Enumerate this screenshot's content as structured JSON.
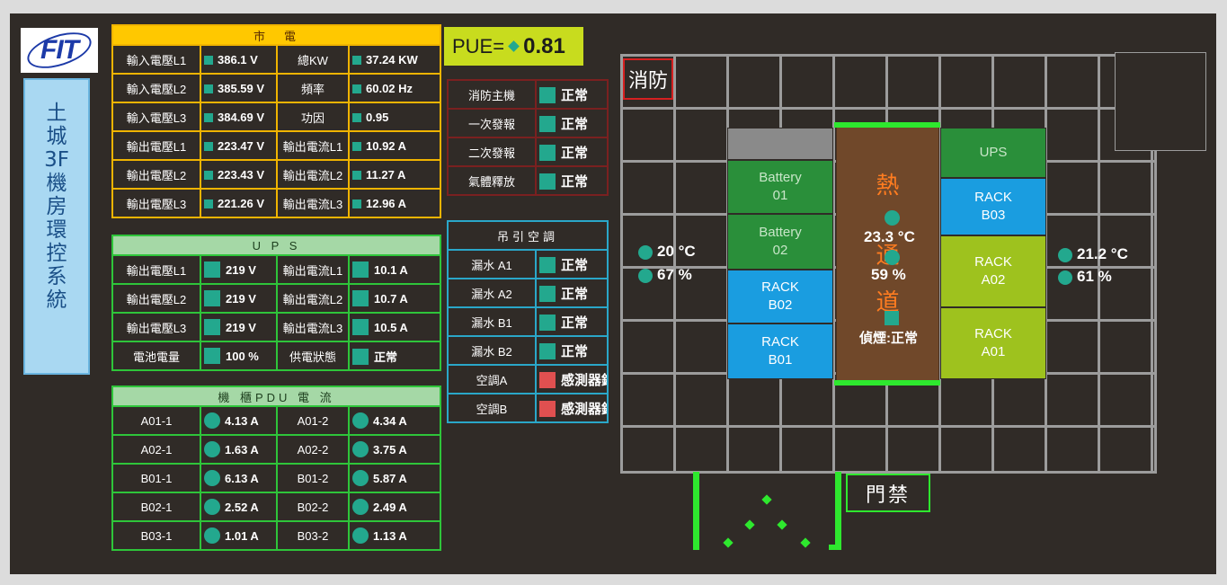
{
  "logo_text": "FIT",
  "system_title": "土城3F機房環控系統",
  "mains": {
    "header": "市　電",
    "rows": [
      {
        "l1": "輸入電壓L1",
        "v1": "386.1 V",
        "l2": "總KW",
        "v2": "37.24 KW"
      },
      {
        "l1": "輸入電壓L2",
        "v1": "385.59 V",
        "l2": "頻率",
        "v2": "60.02 Hz"
      },
      {
        "l1": "輸入電壓L3",
        "v1": "384.69 V",
        "l2": "功因",
        "v2": "0.95"
      },
      {
        "l1": "輸出電壓L1",
        "v1": "223.47 V",
        "l2": "輸出電流L1",
        "v2": "10.92 A"
      },
      {
        "l1": "輸出電壓L2",
        "v1": "223.43 V",
        "l2": "輸出電流L2",
        "v2": "11.27 A"
      },
      {
        "l1": "輸出電壓L3",
        "v1": "221.26 V",
        "l2": "輸出電流L3",
        "v2": "12.96 A"
      }
    ]
  },
  "ups": {
    "header": "U P S",
    "rows": [
      {
        "l1": "輸出電壓L1",
        "v1": "219 V",
        "l2": "輸出電流L1",
        "v2": "10.1 A"
      },
      {
        "l1": "輸出電壓L2",
        "v1": "219 V",
        "l2": "輸出電流L2",
        "v2": "10.7 A"
      },
      {
        "l1": "輸出電壓L3",
        "v1": "219 V",
        "l2": "輸出電流L3",
        "v2": "10.5 A"
      },
      {
        "l1": "電池電量",
        "v1": "100 %",
        "l2": "供電狀態",
        "v2": "正常"
      }
    ]
  },
  "pdu": {
    "header": "機 櫃PDU 電 流",
    "rows": [
      {
        "l1": "A01-1",
        "v1": "4.13 A",
        "l2": "A01-2",
        "v2": "4.34 A"
      },
      {
        "l1": "A02-1",
        "v1": "1.63 A",
        "l2": "A02-2",
        "v2": "3.75 A"
      },
      {
        "l1": "B01-1",
        "v1": "6.13 A",
        "l2": "B01-2",
        "v2": "5.87 A"
      },
      {
        "l1": "B02-1",
        "v1": "2.52 A",
        "l2": "B02-2",
        "v2": "2.49 A"
      },
      {
        "l1": "B03-1",
        "v1": "1.01 A",
        "l2": "B03-2",
        "v2": "1.13 A"
      }
    ]
  },
  "pue": {
    "label": "PUE=",
    "value": "0.81"
  },
  "fire": {
    "rows": [
      {
        "label": "消防主機",
        "status": "正常"
      },
      {
        "label": "一次發報",
        "status": "正常"
      },
      {
        "label": "二次發報",
        "status": "正常"
      },
      {
        "label": "氣體釋放",
        "status": "正常"
      }
    ]
  },
  "ac": {
    "header": "吊引空調",
    "rows": [
      {
        "label": "漏水 A1",
        "status": "正常",
        "state": "ok"
      },
      {
        "label": "漏水 A2",
        "status": "正常",
        "state": "ok"
      },
      {
        "label": "漏水 B1",
        "status": "正常",
        "state": "ok"
      },
      {
        "label": "漏水 B2",
        "status": "正常",
        "state": "ok"
      },
      {
        "label": "空調A",
        "status": "感測器錯誤",
        "state": "error"
      },
      {
        "label": "空調B",
        "status": "感測器錯誤",
        "state": "error"
      }
    ]
  },
  "floorplan": {
    "fire_label": "消防",
    "door_label": "門禁",
    "hot_aisle": {
      "chars": [
        "熱",
        "通",
        "道"
      ],
      "temp": "23.3 °C",
      "humidity": "59 %",
      "smoke": "偵煙:正常"
    },
    "left_sensor": {
      "temp": "20 °C",
      "humidity": "67 %"
    },
    "right_sensor": {
      "temp": "21.2 °C",
      "humidity": "61 %"
    },
    "left_racks": [
      {
        "label": "",
        "color": "gray"
      },
      {
        "label": "Battery\n01",
        "color": "green"
      },
      {
        "label": "Battery\n02",
        "color": "green"
      },
      {
        "label": "RACK\nB02",
        "color": "blue"
      },
      {
        "label": "RACK\nB01",
        "color": "blue"
      }
    ],
    "right_racks": [
      {
        "label": "UPS",
        "color": "green"
      },
      {
        "label": "RACK\nB03",
        "color": "blue"
      },
      {
        "label": "RACK\nA02",
        "color": "lime"
      },
      {
        "label": "RACK\nA01",
        "color": "lime"
      }
    ]
  },
  "colors": {
    "ok": "#23a88e",
    "error": "#e05050",
    "mains_border": "#f0b400",
    "ups_border": "#2ec53a",
    "ac_border": "#2aa7c9",
    "fire_border": "#7a2020"
  }
}
